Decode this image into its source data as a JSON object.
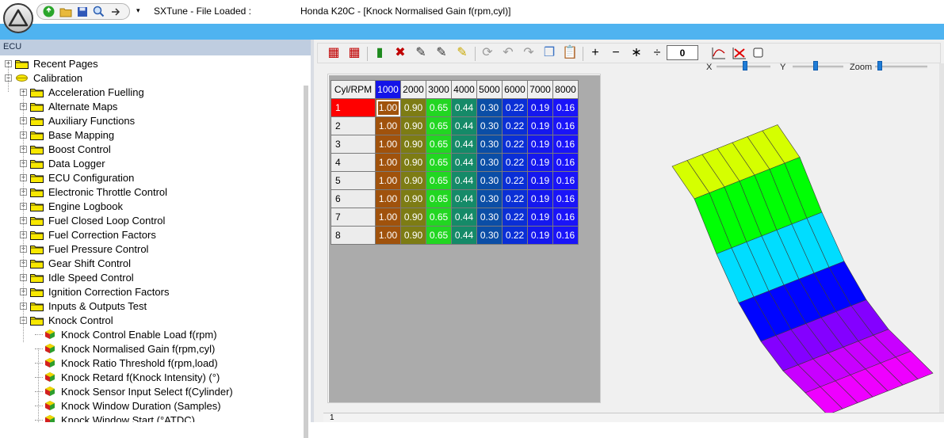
{
  "titlebar": {
    "app_title": "SXTune - File Loaded :",
    "document_title": "Honda K20C - [Knock Normalised Gain f(rpm,cyl)]",
    "qat_dropdown": "▾",
    "qat_icons": [
      "back-icon",
      "open-folder-icon",
      "save-icon",
      "search-icon",
      "forward-icon"
    ]
  },
  "ribbon": {
    "color": "#4fb3f0"
  },
  "left_panel": {
    "header": "ECU",
    "tree": [
      {
        "label": "Recent Pages",
        "level": 0,
        "type": "folder",
        "expander": "+"
      },
      {
        "label": "Calibration",
        "level": 0,
        "type": "folder-open",
        "expander": "−"
      },
      {
        "label": "Acceleration Fuelling",
        "level": 1,
        "type": "folder",
        "expander": "+"
      },
      {
        "label": "Alternate Maps",
        "level": 1,
        "type": "folder",
        "expander": "+"
      },
      {
        "label": "Auxiliary Functions",
        "level": 1,
        "type": "folder",
        "expander": "+"
      },
      {
        "label": "Base Mapping",
        "level": 1,
        "type": "folder",
        "expander": "+"
      },
      {
        "label": "Boost Control",
        "level": 1,
        "type": "folder",
        "expander": "+"
      },
      {
        "label": "Data Logger",
        "level": 1,
        "type": "folder",
        "expander": "+"
      },
      {
        "label": "ECU Configuration",
        "level": 1,
        "type": "folder",
        "expander": "+"
      },
      {
        "label": "Electronic Throttle Control",
        "level": 1,
        "type": "folder",
        "expander": "+"
      },
      {
        "label": "Engine Logbook",
        "level": 1,
        "type": "folder",
        "expander": "+"
      },
      {
        "label": "Fuel Closed Loop Control",
        "level": 1,
        "type": "folder",
        "expander": "+"
      },
      {
        "label": "Fuel Correction Factors",
        "level": 1,
        "type": "folder",
        "expander": "+"
      },
      {
        "label": "Fuel Pressure Control",
        "level": 1,
        "type": "folder",
        "expander": "+"
      },
      {
        "label": "Gear Shift Control",
        "level": 1,
        "type": "folder",
        "expander": "+"
      },
      {
        "label": "Idle Speed Control",
        "level": 1,
        "type": "folder",
        "expander": "+"
      },
      {
        "label": "Ignition Correction Factors",
        "level": 1,
        "type": "folder",
        "expander": "+"
      },
      {
        "label": "Inputs & Outputs Test",
        "level": 1,
        "type": "folder",
        "expander": "+"
      },
      {
        "label": "Knock Control",
        "level": 1,
        "type": "folder",
        "expander": "−"
      },
      {
        "label": "Knock Control Enable Load f(rpm)",
        "level": 2,
        "type": "map"
      },
      {
        "label": "Knock Normalised Gain f(rpm,cyl)",
        "level": 2,
        "type": "map",
        "selected": true
      },
      {
        "label": "Knock Ratio Threshold f(rpm,load)",
        "level": 2,
        "type": "map"
      },
      {
        "label": "Knock Retard f(Knock Intensity) (°)",
        "level": 2,
        "type": "map"
      },
      {
        "label": "Knock Sensor Input Select f(Cylinder)",
        "level": 2,
        "type": "map"
      },
      {
        "label": "Knock Window Duration (Samples)",
        "level": 2,
        "type": "map"
      },
      {
        "label": "Knock Window Start (°ATDC)",
        "level": 2,
        "type": "map"
      }
    ]
  },
  "toolbar": {
    "step_value": "0",
    "buttons": [
      {
        "name": "insert-row-button",
        "glyph": "▦",
        "color": "#c00000"
      },
      {
        "name": "insert-column-button",
        "glyph": "▦",
        "color": "#c00000"
      },
      {
        "name": "fill-button",
        "glyph": "▮",
        "color": "#1e8a1e"
      },
      {
        "name": "clear-button",
        "glyph": "✖",
        "color": "#c00000"
      },
      {
        "name": "edit-cell-button",
        "glyph": "✎",
        "color": "#333333"
      },
      {
        "name": "interpolate-button",
        "glyph": "✎",
        "color": "#333333"
      },
      {
        "name": "highlight-button",
        "glyph": "✎",
        "color": "#c9a800"
      },
      {
        "name": "refresh-button",
        "glyph": "⟳",
        "color": "#9a9a9a"
      },
      {
        "name": "undo-button",
        "glyph": "↶",
        "color": "#9a9a9a"
      },
      {
        "name": "redo-button",
        "glyph": "↷",
        "color": "#9a9a9a"
      },
      {
        "name": "copy-button",
        "glyph": "❐",
        "color": "#3a72c4"
      },
      {
        "name": "paste-button",
        "glyph": "📋",
        "color": "#3a72c4"
      },
      {
        "name": "add-button",
        "glyph": "+",
        "color": "#000000"
      },
      {
        "name": "subtract-button",
        "glyph": "−",
        "color": "#000000"
      },
      {
        "name": "multiply-button",
        "glyph": "∗",
        "color": "#000000"
      },
      {
        "name": "divide-button",
        "glyph": "÷",
        "color": "#000000"
      }
    ]
  },
  "view_controls": {
    "x_label": "X",
    "y_label": "Y",
    "zoom_label": "Zoom"
  },
  "table": {
    "corner_label": "Cyl/RPM",
    "rpm": [
      "1000",
      "2000",
      "3000",
      "4000",
      "5000",
      "6000",
      "7000",
      "8000"
    ],
    "cylinders": [
      "1",
      "2",
      "3",
      "4",
      "5",
      "6",
      "7",
      "8"
    ],
    "row_values": [
      "1.00",
      "0.90",
      "0.65",
      "0.44",
      "0.30",
      "0.22",
      "0.19",
      "0.16"
    ],
    "column_colors": [
      "#a0520c",
      "#7d7c14",
      "#22d622",
      "#158a68",
      "#0b4ea6",
      "#0a2fd6",
      "#1518ee",
      "#1a14f8"
    ],
    "selected_column": 0,
    "selected_row": 0
  },
  "status": {
    "bottom_text": "1"
  }
}
